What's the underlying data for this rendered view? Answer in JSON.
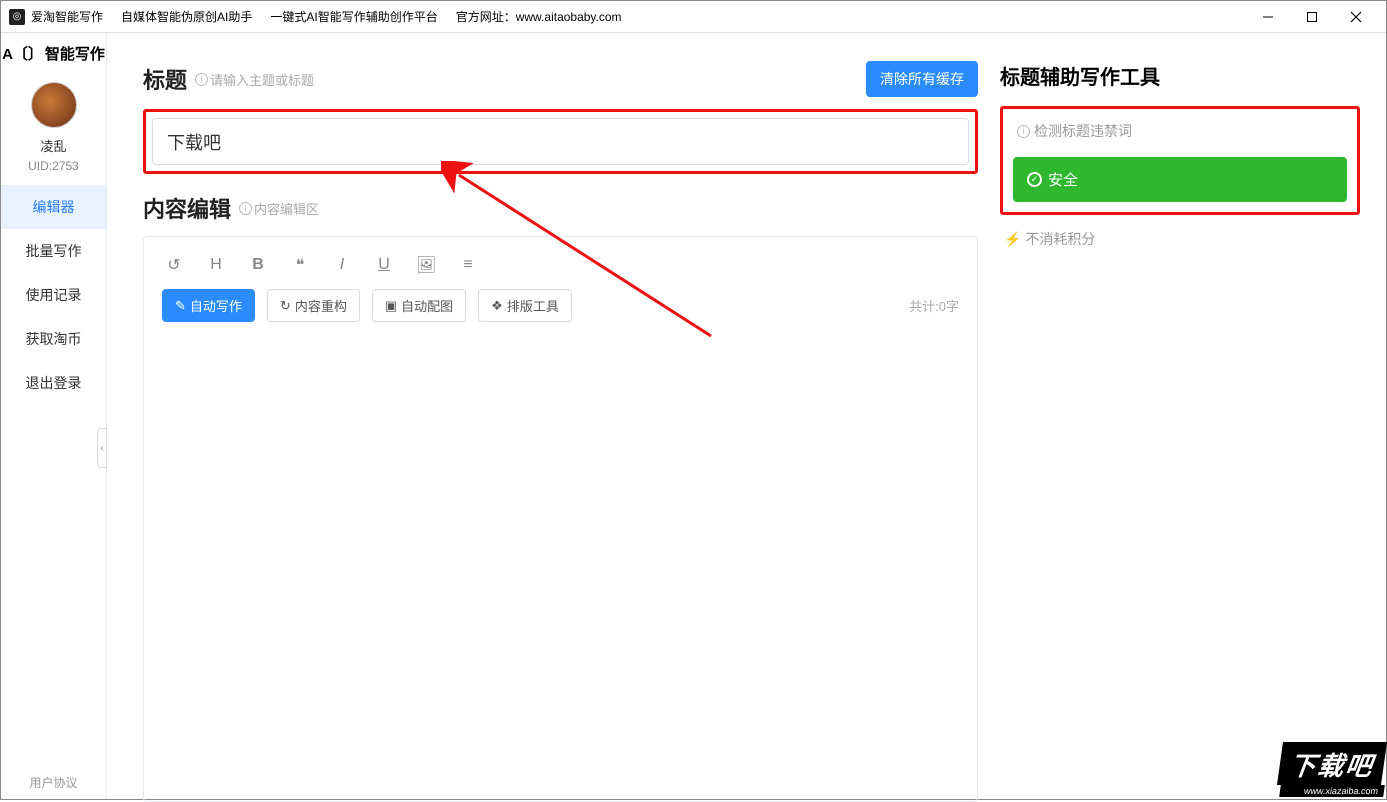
{
  "titlebar": {
    "app_name": "爱淘智能写作",
    "tagline1": "自媒体智能伪原创AI助手",
    "tagline2": "一键式AI智能写作辅助创作平台",
    "site_label": "官方网址：",
    "site_url": "www.aitaobaby.com"
  },
  "sidebar": {
    "logo": "智能写作",
    "logo_prefix": "A",
    "username": "凌乱",
    "uid": "UID:2753",
    "items": [
      "编辑器",
      "批量写作",
      "使用记录",
      "获取淘币",
      "退出登录"
    ],
    "agreement": "用户协议"
  },
  "main": {
    "title_label": "标题",
    "title_hint": "请输入主题或标题",
    "clear_cache": "清除所有缓存",
    "title_value": "下载吧",
    "content_label": "内容编辑",
    "content_hint": "内容编辑区",
    "actions": {
      "auto_write": "自动写作",
      "restructure": "内容重构",
      "auto_image": "自动配图",
      "layout_tool": "排版工具"
    },
    "word_count": "共计:0字"
  },
  "panel": {
    "title": "标题辅助写作工具",
    "check_label": "检测标题违禁词",
    "safe": "安全",
    "no_cost": "不消耗积分"
  },
  "watermark": {
    "text": "下载吧",
    "url": "www.xiazaiba.com"
  }
}
